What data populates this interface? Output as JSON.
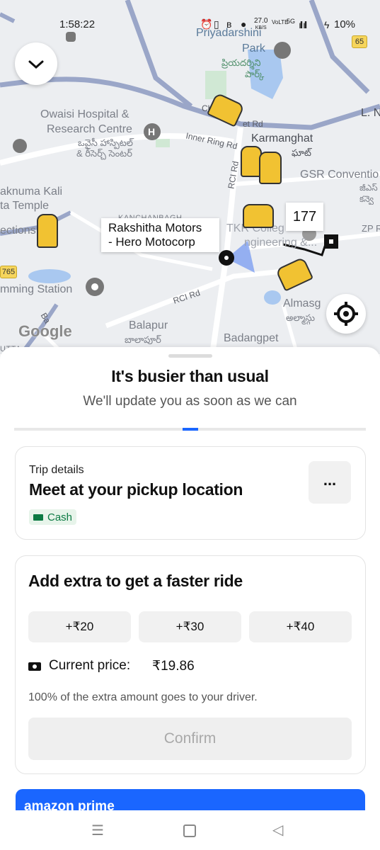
{
  "status_bar": {
    "time": "1:58:22",
    "net_speed_value": "27.0",
    "net_speed_unit": "KB/S",
    "volte": "VoLTE",
    "signal_type": "5G",
    "battery": "10%"
  },
  "map": {
    "labels": {
      "priyadarshini": "Priyadarshini",
      "park": "Park",
      "park_telugu_1": "ప్రియదర్శిని",
      "park_telugu_2": "పార్క్",
      "owaisi_1": "Owaisi Hospital &",
      "owaisi_2": "Research Centre",
      "owaisi_te_1": "ఒవైసీ హాస్పిటల్",
      "owaisi_te_2": "& రీసెర్చ్ సెంటర్",
      "karmanghat": "Karmanghat",
      "karmanghat_te": "ఘాట్",
      "gsr": "GSR Conventio",
      "gsr_te_1": "జీఎస్",
      "gsr_te_2": "కన్వె",
      "l_n": "L. N",
      "knuma": "aknuma Kali",
      "temple": "ta Temple",
      "kanchanbagh": "KANCHANBAGH",
      "tkr_1": "TKR Colleg",
      "tkr_2": "ngineering &...",
      "zp": "ZP R",
      "ections": "ections",
      "swimming": "mming Station",
      "almasg": "Almasg",
      "almasg_te": "అల్మాస్గు",
      "balapur": "Balapur",
      "balapur_te": "బాలాపూర్",
      "badangpet": "Badangpet",
      "utta": "UTTA",
      "ba": "Ba",
      "road_inner_ring": "Inner Ring Rd",
      "road_rci_vertical": "RCI Rd",
      "road_rci": "RCI Rd",
      "road_char": "Ch",
      "road_et": "et Rd",
      "shield_65": "65",
      "shield_765": "765",
      "google": "Google"
    },
    "tooltip_line_1": "Rakshitha Motors",
    "tooltip_line_2": "- Hero Motocorp",
    "route_badge": "177"
  },
  "sheet": {
    "title": "It's busier than usual",
    "subtitle": "We'll update you as soon as we can",
    "progress": 0.06,
    "trip": {
      "label": "Trip details",
      "heading": "Meet at your pickup location",
      "payment": "Cash",
      "more_label": "..."
    },
    "extra": {
      "heading": "Add extra to get a faster ride",
      "options": [
        "+₹20",
        "+₹30",
        "+₹40"
      ],
      "current_price_label": "Current price:",
      "current_price_value": "₹19.86",
      "note": "100% of the extra amount goes to your driver.",
      "confirm_label": "Confirm"
    },
    "ad_text": "amazon prime"
  },
  "colors": {
    "accent_blue": "#1a66ff",
    "auto_yellow": "#f1c232",
    "cash_green": "#0c7a43"
  }
}
